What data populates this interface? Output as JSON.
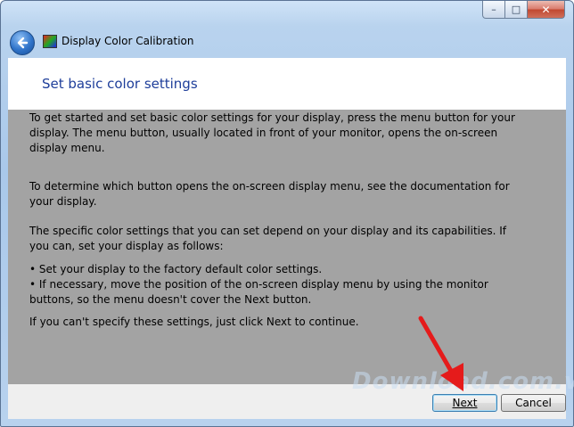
{
  "window": {
    "title": "Display Color Calibration",
    "controls": {
      "minimize": "–",
      "maximize": "□",
      "close": "✕"
    }
  },
  "header": {
    "heading": "Set basic color settings"
  },
  "content": {
    "para1": "To get started and set basic color settings for your display, press the menu button for your display. The menu button, usually located in front of your monitor, opens the on-screen display menu.",
    "para2": "To determine which button opens the on-screen display menu, see the documentation for your display.",
    "para3": "The specific color settings that you can set depend on your display and its capabilities. If you can, set your display as follows:",
    "bullet1": "• Set your display to the factory default color settings.",
    "bullet2": "• If necessary, move the position of the on-screen display menu by using the monitor buttons, so the menu doesn't cover the Next button.",
    "para4": "If you can't specify these settings,  just click Next to continue."
  },
  "footer": {
    "next_label": "Next",
    "cancel_label": "Cancel"
  },
  "watermark": "Download.com.vn",
  "colors": {
    "heading": "#1e3e9a",
    "content_bg": "#a3a3a3",
    "annotation_arrow": "#e51b1b"
  }
}
